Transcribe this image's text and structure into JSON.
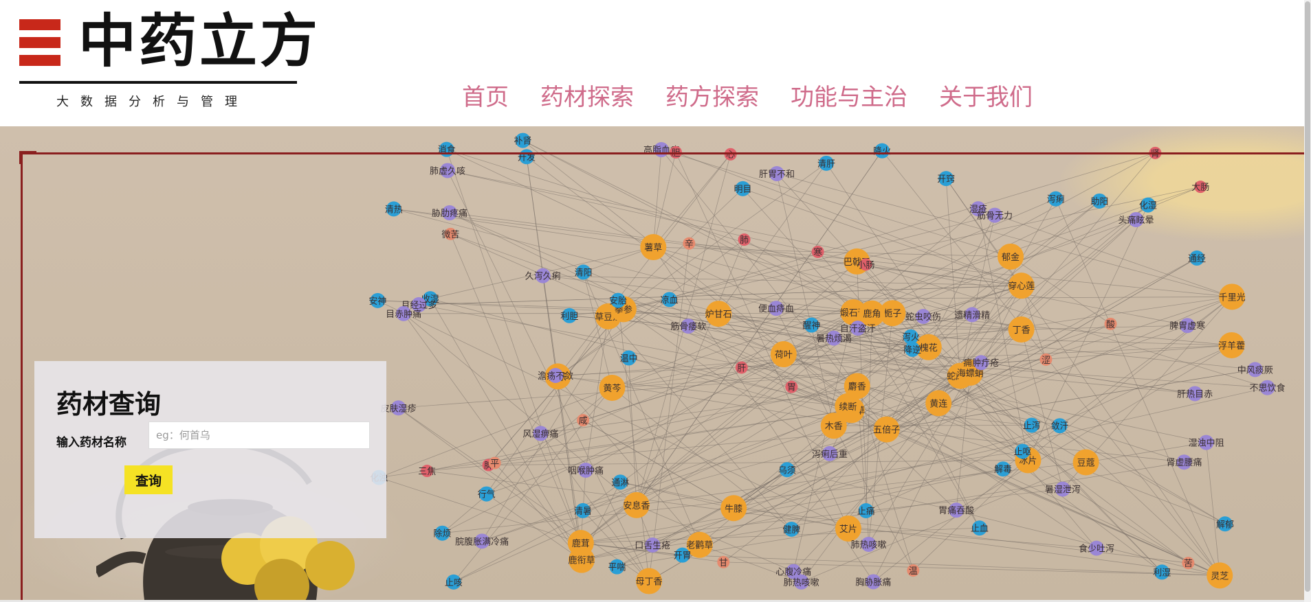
{
  "logo": {
    "title": "中药立方",
    "subtitle": "大数据分析与管理",
    "accent": "#c8281a"
  },
  "nav": {
    "items": [
      "首页",
      "药材探索",
      "药方探索",
      "功能与主治",
      "关于我们"
    ],
    "color": "#cf6b8a"
  },
  "query": {
    "title": "药材查询",
    "input_label": "输入药材名称",
    "input_placeholder": "eg：何首乌",
    "input_value": "",
    "button_label": "查询",
    "button_color": "#f5e224"
  },
  "network": {
    "node_colors": {
      "herb": "#f0a22e",
      "function": "#9a86d6",
      "effect": "#2a9fd6",
      "property": "#e0606a",
      "taste": "#e68a6e"
    },
    "nodes": [
      {
        "label": "五倍子",
        "type": "herb"
      },
      {
        "label": "草豆蔻",
        "type": "herb"
      },
      {
        "label": "翻白草",
        "type": "herb"
      },
      {
        "label": "鹿茸",
        "type": "herb"
      },
      {
        "label": "蛇床子",
        "type": "herb"
      },
      {
        "label": "牛膝",
        "type": "herb"
      },
      {
        "label": "郁金",
        "type": "herb"
      },
      {
        "label": "栀子",
        "type": "herb"
      },
      {
        "label": "穿心莲",
        "type": "herb"
      },
      {
        "label": "黄连",
        "type": "herb"
      },
      {
        "label": "薯草",
        "type": "herb"
      },
      {
        "label": "灵芝",
        "type": "herb"
      },
      {
        "label": "黄芩",
        "type": "herb"
      },
      {
        "label": "千里光",
        "type": "herb"
      },
      {
        "label": "木香",
        "type": "herb"
      },
      {
        "label": "丁香",
        "type": "herb"
      },
      {
        "label": "母丁香",
        "type": "herb"
      },
      {
        "label": "煅石膏",
        "type": "herb"
      },
      {
        "label": "槐花",
        "type": "herb"
      },
      {
        "label": "安息香",
        "type": "herb"
      },
      {
        "label": "荷叶",
        "type": "herb"
      },
      {
        "label": "鹿衔草",
        "type": "herb"
      },
      {
        "label": "老鹳草",
        "type": "herb"
      },
      {
        "label": "鹿角",
        "type": "herb"
      },
      {
        "label": "海螵蛸",
        "type": "herb"
      },
      {
        "label": "豆蔻",
        "type": "herb"
      },
      {
        "label": "拳参",
        "type": "herb"
      },
      {
        "label": "巴戟天",
        "type": "herb"
      },
      {
        "label": "儿茶",
        "type": "herb"
      },
      {
        "label": "冰片",
        "type": "herb"
      },
      {
        "label": "浮羊藿",
        "type": "herb"
      },
      {
        "label": "续断",
        "type": "herb"
      },
      {
        "label": "艾片",
        "type": "herb"
      },
      {
        "label": "麝香",
        "type": "herb"
      },
      {
        "label": "炉甘石",
        "type": "herb"
      },
      {
        "label": "泻痢",
        "type": "effect"
      },
      {
        "label": "通淋",
        "type": "effect"
      },
      {
        "label": "利湿",
        "type": "effect"
      },
      {
        "label": "解郁",
        "type": "effect"
      },
      {
        "label": "敛汗",
        "type": "effect"
      },
      {
        "label": "降火",
        "type": "effect"
      },
      {
        "label": "凉血",
        "type": "effect"
      },
      {
        "label": "利胆",
        "type": "effect"
      },
      {
        "label": "解毒",
        "type": "effect"
      },
      {
        "label": "平喘",
        "type": "effect"
      },
      {
        "label": "安神",
        "type": "effect"
      },
      {
        "label": "泻火",
        "type": "effect"
      },
      {
        "label": "止咳",
        "type": "effect"
      },
      {
        "label": "健脾",
        "type": "effect"
      },
      {
        "label": "降逆",
        "type": "effect"
      },
      {
        "label": "行气",
        "type": "effect"
      },
      {
        "label": "通经",
        "type": "effect"
      },
      {
        "label": "清热",
        "type": "effect"
      },
      {
        "label": "止呕",
        "type": "effect"
      },
      {
        "label": "止血",
        "type": "effect"
      },
      {
        "label": "清暑",
        "type": "effect"
      },
      {
        "label": "升发",
        "type": "effect"
      },
      {
        "label": "消食",
        "type": "effect"
      },
      {
        "label": "止痛",
        "type": "effect"
      },
      {
        "label": "化湿",
        "type": "effect"
      },
      {
        "label": "清肝",
        "type": "effect"
      },
      {
        "label": "温中",
        "type": "effect"
      },
      {
        "label": "收湿",
        "type": "effect"
      },
      {
        "label": "清阳",
        "type": "effect"
      },
      {
        "label": "助阳",
        "type": "effect"
      },
      {
        "label": "补肾",
        "type": "effect"
      },
      {
        "label": "开窍",
        "type": "effect"
      },
      {
        "label": "明目",
        "type": "effect"
      },
      {
        "label": "醒神",
        "type": "effect"
      },
      {
        "label": "化浊",
        "type": "effect"
      },
      {
        "label": "乌须",
        "type": "effect"
      },
      {
        "label": "开胃",
        "type": "effect"
      },
      {
        "label": "止泻",
        "type": "effect"
      },
      {
        "label": "安胎",
        "type": "effect"
      },
      {
        "label": "除烦",
        "type": "effect"
      },
      {
        "label": "肺虚久咳",
        "type": "function"
      },
      {
        "label": "久泻久痢",
        "type": "function"
      },
      {
        "label": "皮肤湿疹",
        "type": "function"
      },
      {
        "label": "便血痔血",
        "type": "function"
      },
      {
        "label": "肺热咳嗽",
        "type": "function"
      },
      {
        "label": "自汗盗汗",
        "type": "function"
      },
      {
        "label": "脘腹胀满冷痛",
        "type": "function"
      },
      {
        "label": "痈肿疔疮",
        "type": "function"
      },
      {
        "label": "湿浊中阻",
        "type": "function"
      },
      {
        "label": "心腹冷痛",
        "type": "function"
      },
      {
        "label": "脾胃虚寒",
        "type": "function"
      },
      {
        "label": "泻痢后重",
        "type": "function"
      },
      {
        "label": "食少吐泻",
        "type": "function"
      },
      {
        "label": "胸胁胀痛",
        "type": "function"
      },
      {
        "label": "胃痛吞酸",
        "type": "function"
      },
      {
        "label": "肝胃不和",
        "type": "function"
      },
      {
        "label": "不思饮食",
        "type": "function"
      },
      {
        "label": "遗精滑精",
        "type": "function"
      },
      {
        "label": "暑湿泄泻",
        "type": "function"
      },
      {
        "label": "暑热烦渴",
        "type": "function"
      },
      {
        "label": "肾虚腰痛",
        "type": "function"
      },
      {
        "label": "月经过多",
        "type": "function"
      },
      {
        "label": "肺热咳嗽",
        "type": "function"
      },
      {
        "label": "湿疮",
        "type": "function"
      },
      {
        "label": "筋骨无力",
        "type": "function"
      },
      {
        "label": "澹疡不敛",
        "type": "function"
      },
      {
        "label": "高脂血症",
        "type": "function"
      },
      {
        "label": "中风痰厥",
        "type": "function"
      },
      {
        "label": "目赤肿痛",
        "type": "function"
      },
      {
        "label": "风湿痹痛",
        "type": "function"
      },
      {
        "label": "咽喉肿痛",
        "type": "function"
      },
      {
        "label": "口舌生疮",
        "type": "function"
      },
      {
        "label": "蛇虫咬伤",
        "type": "function"
      },
      {
        "label": "头痛眩晕",
        "type": "function"
      },
      {
        "label": "筋骨痿软",
        "type": "function"
      },
      {
        "label": "肝热目赤",
        "type": "function"
      },
      {
        "label": "胁肋疼痛",
        "type": "function"
      },
      {
        "label": "寒",
        "type": "property"
      },
      {
        "label": "肝",
        "type": "property"
      },
      {
        "label": "胆",
        "type": "property"
      },
      {
        "label": "三焦",
        "type": "property"
      },
      {
        "label": "胃",
        "type": "property"
      },
      {
        "label": "大肠",
        "type": "property"
      },
      {
        "label": "肺",
        "type": "property"
      },
      {
        "label": "心",
        "type": "property"
      },
      {
        "label": "脾",
        "type": "property"
      },
      {
        "label": "肾",
        "type": "property"
      },
      {
        "label": "小肠",
        "type": "property"
      },
      {
        "label": "辛",
        "type": "taste"
      },
      {
        "label": "涩",
        "type": "taste"
      },
      {
        "label": "咸",
        "type": "taste"
      },
      {
        "label": "苦",
        "type": "taste"
      },
      {
        "label": "甘",
        "type": "taste"
      },
      {
        "label": "酸",
        "type": "taste"
      },
      {
        "label": "微苦",
        "type": "taste"
      },
      {
        "label": "平",
        "type": "taste"
      },
      {
        "label": "温",
        "type": "taste"
      }
    ]
  }
}
